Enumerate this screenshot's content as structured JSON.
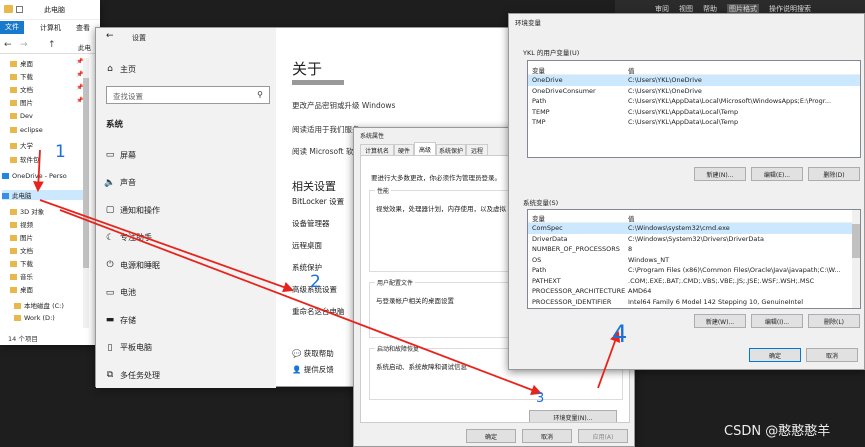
{
  "explorer": {
    "title": "此电脑",
    "menu": [
      "文件",
      "计算机",
      "查看"
    ],
    "address": "此电",
    "nav": [
      {
        "label": "桌面",
        "icon": "folder-icon",
        "pin": true
      },
      {
        "label": "下载",
        "icon": "download-icon",
        "pin": true
      },
      {
        "label": "文档",
        "icon": "document-icon",
        "pin": true
      },
      {
        "label": "图片",
        "icon": "picture-icon",
        "pin": true
      },
      {
        "label": "Dev",
        "icon": "folder-icon",
        "pin": false
      },
      {
        "label": "eclipse",
        "icon": "folder-icon",
        "pin": false
      },
      {
        "label": "大学",
        "icon": "folder-icon",
        "pin": false
      },
      {
        "label": "软件包",
        "icon": "folder-icon",
        "pin": false
      },
      {
        "label": "OneDrive - Perso",
        "icon": "cloud-icon",
        "pin": false
      },
      {
        "label": "此电脑",
        "icon": "computer-icon",
        "pin": false
      },
      {
        "label": "3D 对象",
        "icon": "cube-icon",
        "pin": false
      },
      {
        "label": "视频",
        "icon": "video-icon",
        "pin": false
      },
      {
        "label": "图片",
        "icon": "picture-icon",
        "pin": false
      },
      {
        "label": "文档",
        "icon": "document-icon",
        "pin": false
      },
      {
        "label": "下载",
        "icon": "download-icon",
        "pin": false
      },
      {
        "label": "音乐",
        "icon": "music-icon",
        "pin": false
      },
      {
        "label": "桌面",
        "icon": "desktop-icon",
        "pin": false
      },
      {
        "label": "本地磁盘 (C:)",
        "icon": "drive-icon",
        "pin": false
      },
      {
        "label": "Work (D:)",
        "icon": "drive-icon",
        "pin": false
      }
    ],
    "status": "14 个项目"
  },
  "top_menu": [
    "审阅",
    "视图",
    "帮助",
    "图片格式",
    "操作说明搜索"
  ],
  "settings": {
    "title": "设置",
    "home": "主页",
    "search_placeholder": "查找设置",
    "section": "系统",
    "nav": [
      {
        "label": "屏幕",
        "icon": "monitor-icon"
      },
      {
        "label": "声音",
        "icon": "speaker-icon"
      },
      {
        "label": "通知和操作",
        "icon": "notification-icon"
      },
      {
        "label": "专注助手",
        "icon": "moon-icon"
      },
      {
        "label": "电源和睡眠",
        "icon": "power-icon"
      },
      {
        "label": "电池",
        "icon": "battery-icon"
      },
      {
        "label": "存储",
        "icon": "storage-icon"
      },
      {
        "label": "平板电脑",
        "icon": "tablet-icon"
      },
      {
        "label": "多任务处理",
        "icon": "multitask-icon"
      }
    ],
    "about_title": "关于",
    "about_lines": [
      "更改产品密钥或升级 Windows",
      "阅读适用于我们服务",
      "阅读 Microsoft 软"
    ],
    "related_title": "相关设置",
    "related_links": [
      "BitLocker 设置",
      "设备管理器",
      "远程桌面",
      "系统保护",
      "高级系统设置",
      "重命名这台电脑"
    ],
    "help": [
      "获取帮助",
      "提供反馈"
    ]
  },
  "sysprops": {
    "title": "系统属性",
    "tabs": [
      "计算机名",
      "硬件",
      "高级",
      "系统保护",
      "远程"
    ],
    "admin_note": "要进行大多数更改，你必须作为管理员登录。",
    "perf_title": "性能",
    "perf_text": "视觉效果，处理器计划，内存使用，以及虚拟",
    "profile_title": "用户配置文件",
    "profile_text": "与登录帐户相关的桌面设置",
    "startup_title": "启动和故障恢复",
    "startup_text": "系统启动、系统故障和调试信息",
    "env_button": "环境变量(N)...",
    "ok": "确定",
    "cancel": "取消",
    "apply": "应用(A)"
  },
  "envvars": {
    "title": "环境变量",
    "user_label": "YKL 的用户变量(U)",
    "col_var": "变量",
    "col_val": "值",
    "user_vars": [
      {
        "name": "OneDrive",
        "value": "C:\\Users\\YKL\\OneDrive"
      },
      {
        "name": "OneDriveConsumer",
        "value": "C:\\Users\\YKL\\OneDrive"
      },
      {
        "name": "Path",
        "value": "C:\\Users\\YKL\\AppData\\Local\\Microsoft\\WindowsApps;E:\\Progr..."
      },
      {
        "name": "TEMP",
        "value": "C:\\Users\\YKL\\AppData\\Local\\Temp"
      },
      {
        "name": "TMP",
        "value": "C:\\Users\\YKL\\AppData\\Local\\Temp"
      }
    ],
    "user_buttons": [
      "新建(N)...",
      "编辑(E)...",
      "删除(D)"
    ],
    "sys_label": "系统变量(S)",
    "sys_vars": [
      {
        "name": "ComSpec",
        "value": "C:\\Windows\\system32\\cmd.exe"
      },
      {
        "name": "DriverData",
        "value": "C:\\Windows\\System32\\Drivers\\DriverData"
      },
      {
        "name": "NUMBER_OF_PROCESSORS",
        "value": "8"
      },
      {
        "name": "OS",
        "value": "Windows_NT"
      },
      {
        "name": "Path",
        "value": "C:\\Program Files (x86)\\Common Files\\Oracle\\Java\\javapath;C:\\W..."
      },
      {
        "name": "PATHEXT",
        "value": ".COM;.EXE;.BAT;.CMD;.VBS;.VBE;.JS;.JSE;.WSF;.WSH;.MSC"
      },
      {
        "name": "PROCESSOR_ARCHITECTURE",
        "value": "AMD64"
      },
      {
        "name": "PROCESSOR_IDENTIFIER",
        "value": "Intel64 Family 6 Model 142 Stepping 10, GenuineIntel"
      }
    ],
    "sys_buttons": [
      "新建(W)...",
      "编辑(I)...",
      "删除(L)"
    ],
    "ok": "确定",
    "cancel": "取消"
  },
  "annotations": [
    "1",
    "2",
    "3",
    "4"
  ],
  "watermark": "CSDN @憨憨憨羊",
  "colors": {
    "arrow": "#e8231c",
    "annotation": "#1a6fd8",
    "selection": "#cce8ff",
    "accent": "#0078d7"
  }
}
